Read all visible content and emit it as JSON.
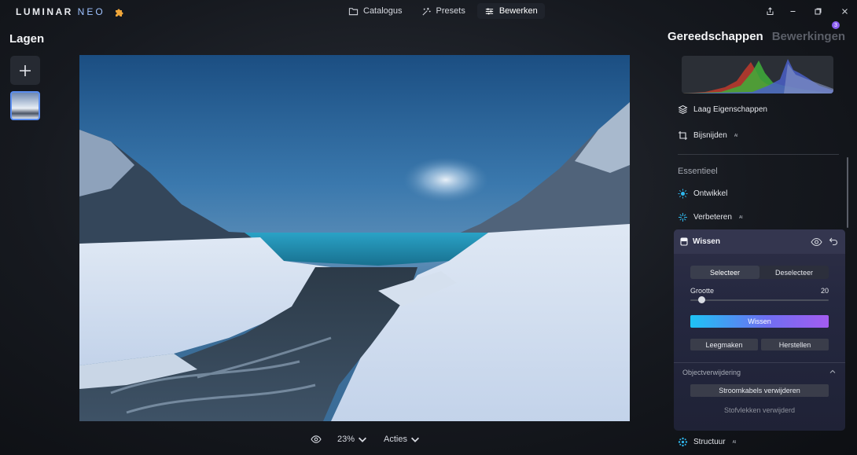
{
  "app": {
    "logo_main": "LUMINAR",
    "logo_sub": "NEO"
  },
  "nav": {
    "items": [
      {
        "label": "Catalogus",
        "icon": "folder-icon",
        "active": false
      },
      {
        "label": "Presets",
        "icon": "sparkle-wand-icon",
        "active": false
      },
      {
        "label": "Bewerken",
        "icon": "sliders-icon",
        "active": true
      }
    ]
  },
  "window_controls": [
    "share-icon",
    "minimize-icon",
    "restore-icon",
    "close-icon"
  ],
  "layers": {
    "title": "Lagen",
    "add_icon": "plus-icon"
  },
  "bottom_bar": {
    "zoom": "23%",
    "actions": "Acties"
  },
  "right_panel": {
    "tab_tools": "Gereedschappen",
    "tab_edits": "Bewerkingen",
    "edits_count": "3",
    "tools": [
      {
        "label": "Laag Eigenschappen",
        "icon": "layers-icon",
        "ai": ""
      },
      {
        "label": "Bijsnijden",
        "icon": "crop-icon",
        "ai": "AI"
      }
    ],
    "section_title": "Essentieel",
    "essentials": [
      {
        "label": "Ontwikkel",
        "icon": "sun-icon",
        "ai": ""
      },
      {
        "label": "Verbeteren",
        "icon": "sparkle-icon",
        "ai": "AI"
      }
    ],
    "wissen": {
      "title": "Wissen",
      "select": "Selecteer",
      "deselect": "Deselecteer",
      "size_label": "Grootte",
      "size_value": "20",
      "size_fraction": 0.08,
      "erase_button": "Wissen",
      "clear_button": "Leegmaken",
      "restore_button": "Herstellen",
      "object_section": "Objectverwijdering",
      "power_lines_button": "Stroomkabels verwijderen",
      "dust_button": "Stofvlekken verwijderd"
    },
    "next_tool": {
      "label": "Structuur",
      "icon": "structure-icon",
      "ai": "AI"
    }
  },
  "colors": {
    "accent_gradient_start": "#1ec3f4",
    "accent_gradient_end": "#a35cf0",
    "panel_active": "#34364f",
    "layer_selected_border": "#5b8ef0"
  }
}
